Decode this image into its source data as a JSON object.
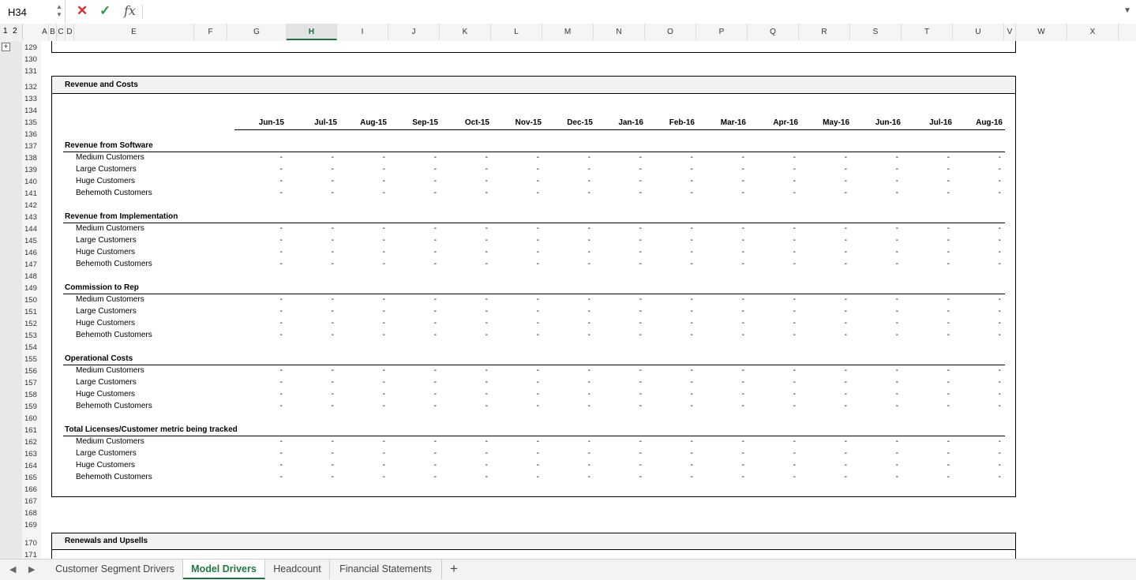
{
  "formula_bar": {
    "name_box": "H34",
    "cancel_icon": "✕",
    "enter_icon": "✓",
    "fx_label": "fx",
    "dropdown_icon": "▼"
  },
  "outline": {
    "levels": [
      "1",
      "2"
    ],
    "expand_symbol": "+"
  },
  "columns": [
    "A",
    "B",
    "C",
    "D",
    "E",
    "F",
    "G",
    "H",
    "I",
    "J",
    "K",
    "L",
    "M",
    "N",
    "O",
    "P",
    "Q",
    "R",
    "S",
    "T",
    "U",
    "V",
    "W",
    "X"
  ],
  "selected_column": "H",
  "rows": [
    "129",
    "130",
    "131",
    "132",
    "133",
    "134",
    "135",
    "136",
    "137",
    "138",
    "139",
    "140",
    "141",
    "142",
    "143",
    "144",
    "145",
    "146",
    "147",
    "148",
    "149",
    "150",
    "151",
    "152",
    "153",
    "154",
    "155",
    "156",
    "157",
    "158",
    "159",
    "160",
    "161",
    "162",
    "163",
    "164",
    "165",
    "166",
    "167",
    "168",
    "169",
    "170",
    "171"
  ],
  "sections": {
    "revenue_costs": {
      "title": "Revenue and Costs",
      "months": [
        "Jun-15",
        "Jul-15",
        "Aug-15",
        "Sep-15",
        "Oct-15",
        "Nov-15",
        "Dec-15",
        "Jan-16",
        "Feb-16",
        "Mar-16",
        "Apr-16",
        "May-16",
        "Jun-16",
        "Jul-16",
        "Aug-16"
      ],
      "groups": [
        {
          "title": "Revenue from Software",
          "items": [
            "Medium Customers",
            "Large Customers",
            "Huge Customers",
            "Behemoth Customers"
          ]
        },
        {
          "title": "Revenue from Implementation",
          "items": [
            "Medium Customers",
            "Large Customers",
            "Huge Customers",
            "Behemoth Customers"
          ]
        },
        {
          "title": "Commission to Rep",
          "items": [
            "Medium Customers",
            "Large Customers",
            "Huge Customers",
            "Behemoth Customers"
          ]
        },
        {
          "title": "Operational Costs",
          "items": [
            "Medium Customers",
            "Large Customers",
            "Huge Customers",
            "Behemoth Customers"
          ]
        },
        {
          "title": "Total Licenses/Customer metric being tracked",
          "items": [
            "Medium Customers",
            "Large Customers",
            "Huge Customers",
            "Behemoth Customers"
          ]
        }
      ],
      "empty_value": "-"
    },
    "renewals": {
      "title": "Renewals and Upsells"
    }
  },
  "tabs": [
    {
      "label": "Customer Segment Drivers",
      "active": false
    },
    {
      "label": "Model Drivers",
      "active": true
    },
    {
      "label": "Headcount",
      "active": false
    },
    {
      "label": "Financial Statements",
      "active": false
    }
  ],
  "add_sheet": "+",
  "nav": {
    "prev": "◀",
    "next": "▶"
  }
}
